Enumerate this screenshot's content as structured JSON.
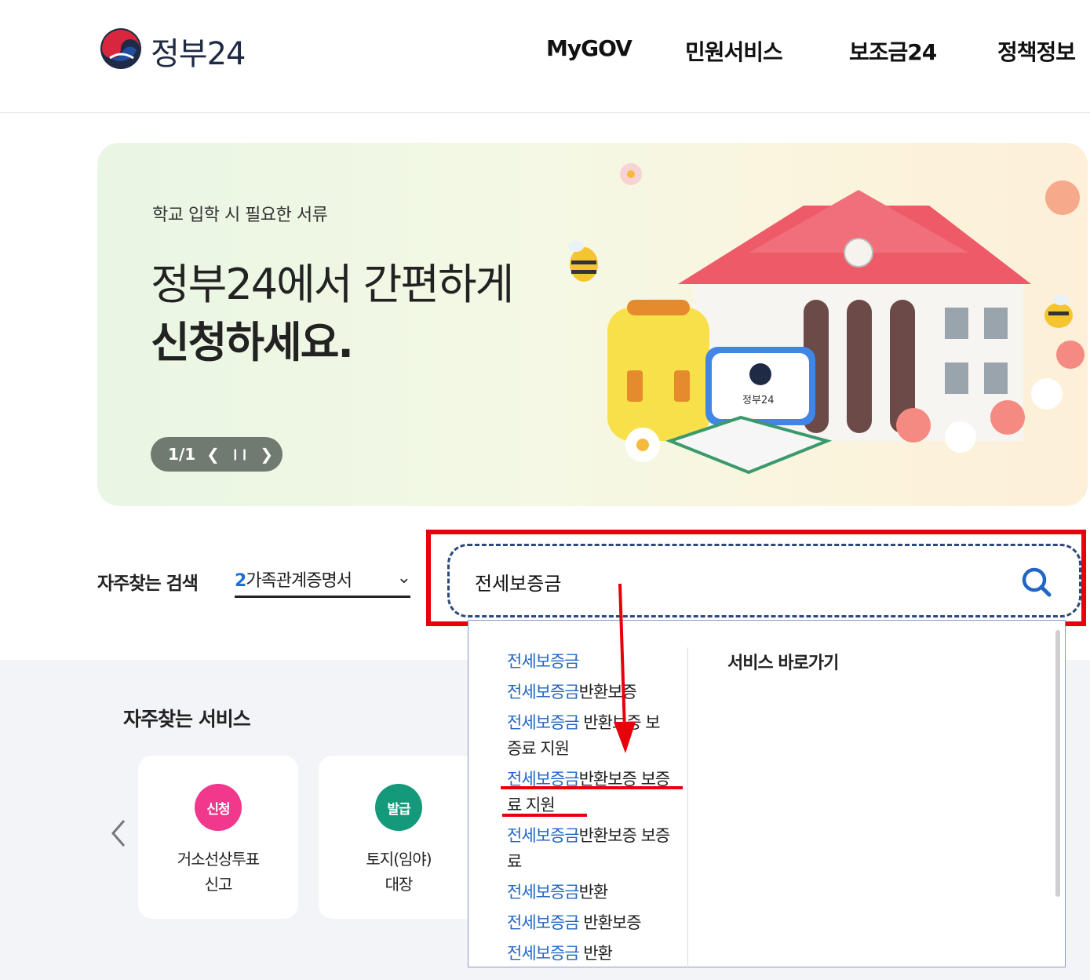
{
  "header": {
    "logo_text": "정부24",
    "nav": [
      "MyGOV",
      "민원서비스",
      "보조금24",
      "정책정보"
    ]
  },
  "banner": {
    "subtitle": "학교 입학 시 필요한 서류",
    "title_line1": "정부24에서 간편하게",
    "title_line2": "신청하세요.",
    "pager_text": "1/1",
    "badge_text": "정부24"
  },
  "search": {
    "keyword_label": "자주찾는 검색",
    "keyword_num": "2",
    "keyword_text": "가족관계증명서",
    "query": "전세보증금"
  },
  "services": {
    "title": "자주찾는 서비스",
    "cards": [
      {
        "badge": "신청",
        "badge_color": "#f0388d",
        "line1": "거소선상투표",
        "line2": "신고"
      },
      {
        "badge": "발급",
        "badge_color": "#14997a",
        "line1": "토지(임야)",
        "line2": "대장"
      }
    ]
  },
  "autocomplete": {
    "right_title": "서비스 바로가기",
    "items": [
      {
        "hl": "전세보증금",
        "rest": "",
        "line2": ""
      },
      {
        "hl": "전세보증금",
        "rest": "반환보증",
        "line2": ""
      },
      {
        "hl": "전세보증금",
        "rest": " 반환보증 보",
        "line2": "증료 지원"
      },
      {
        "hl": "전세보증금",
        "rest": "반환보증 보증",
        "line2": "료 지원"
      },
      {
        "hl": "전세보증금",
        "rest": "반환보증 보증",
        "line2": "료"
      },
      {
        "hl": "전세보증금",
        "rest": "반환",
        "line2": ""
      },
      {
        "hl": "전세보증금",
        "rest": " 반환보증",
        "line2": ""
      },
      {
        "hl": "전세보증금",
        "rest": " 반환",
        "line2": ""
      }
    ]
  },
  "colors": {
    "accent_blue": "#2266c4",
    "annotation_red": "#e8000b"
  }
}
